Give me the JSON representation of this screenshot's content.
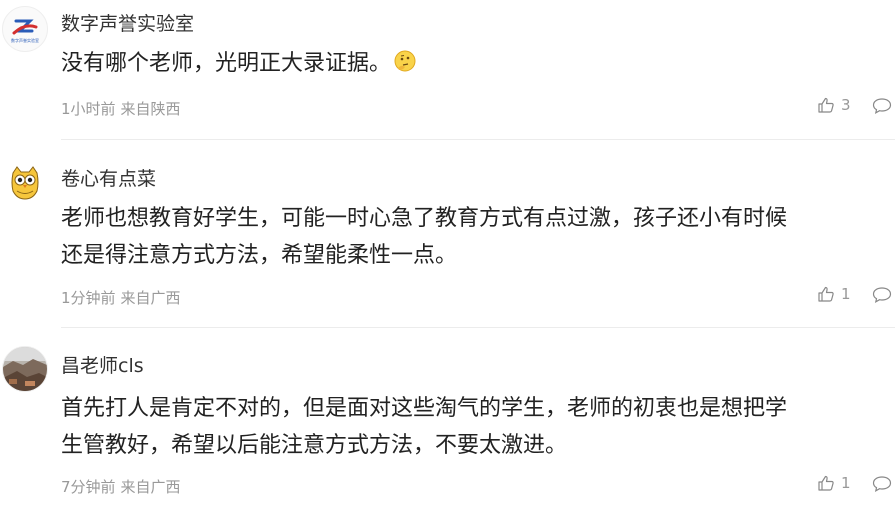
{
  "comments": [
    {
      "username": "数字声誉实验室",
      "avatar_icon": "lab-logo-avatar",
      "avatar_caption": "数字声誉实验室",
      "content_lines": [
        "没有哪个老师，光明正大录证据。"
      ],
      "emoji_icon": "thinking-face-emoji",
      "time": "1小时前",
      "location": "来自陕西",
      "likes": "3"
    },
    {
      "username": "卷心有点菜",
      "avatar_icon": "owl-cartoon-avatar",
      "content_lines": [
        "老师也想教育好学生，可能一时心急了教育方式有点过激，孩子还小有时候",
        "还是得注意方式方法，希望能柔性一点。"
      ],
      "time": "1分钟前",
      "location": "来自广西",
      "likes": "1"
    },
    {
      "username": "昌老师cls",
      "avatar_icon": "photo-avatar",
      "content_lines": [
        "首先打人是肯定不对的，但是面对这些淘气的学生，老师的初衷也是想把学",
        "生管教好，希望以后能注意方式方法，不要太激进。"
      ],
      "time": "7分钟前",
      "location": "来自广西",
      "likes": "1"
    }
  ],
  "icons": {
    "like": "thumbs-up-icon",
    "reply": "comment-bubble-icon"
  },
  "colors": {
    "text": "#222222",
    "meta": "#999999",
    "divider": "#ececec"
  }
}
